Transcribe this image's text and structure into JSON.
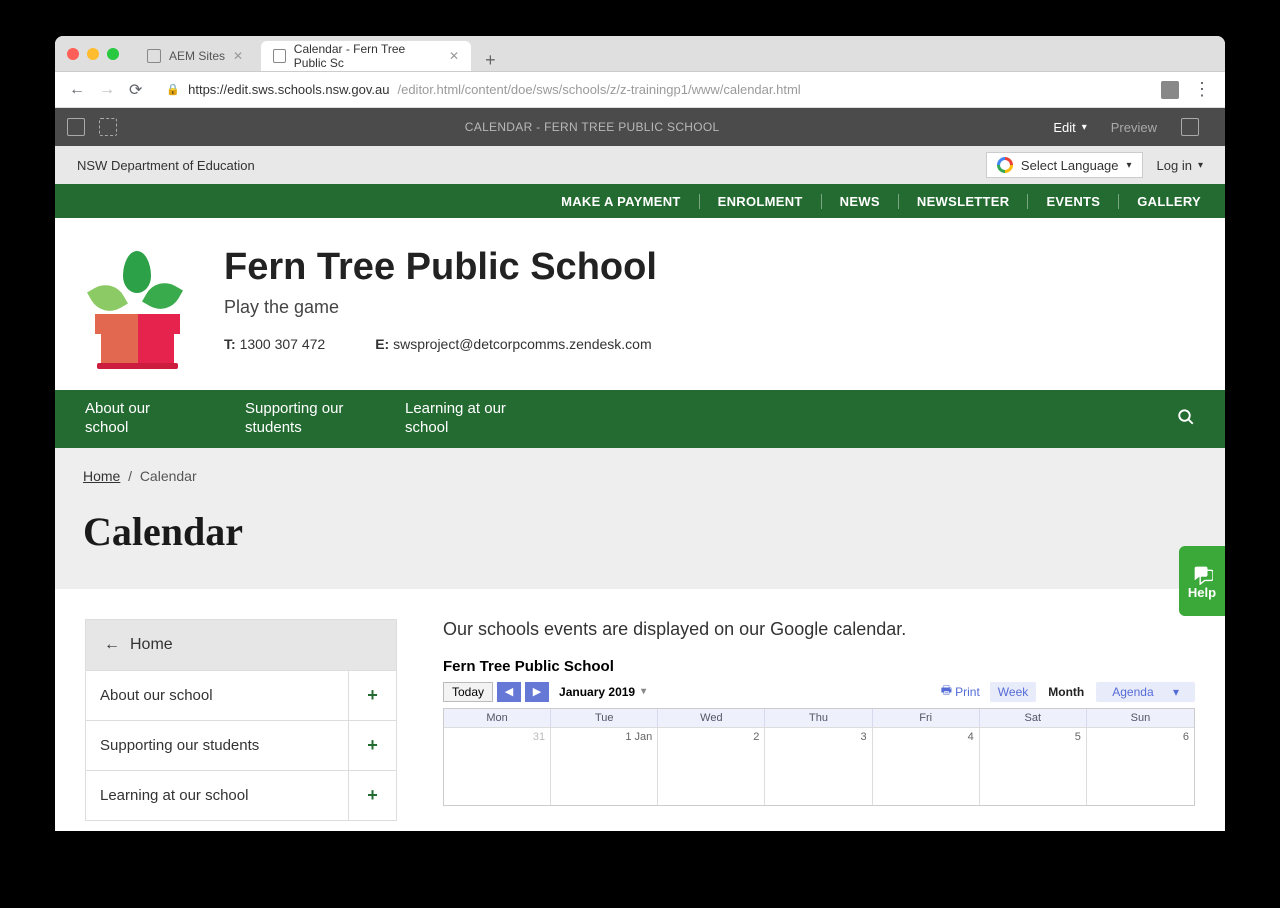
{
  "browser": {
    "tabs": [
      {
        "title": "AEM Sites",
        "active": false
      },
      {
        "title": "Calendar - Fern Tree Public Sc",
        "active": true
      }
    ],
    "url_secure_host": "https://edit.sws.schools.nsw.gov.au",
    "url_path": "/editor.html/content/doe/sws/schools/z/z-trainingp1/www/calendar.html"
  },
  "aem": {
    "title": "CALENDAR - FERN TREE PUBLIC SCHOOL",
    "edit": "Edit",
    "preview": "Preview"
  },
  "topstrip": {
    "dept": "NSW Department of Education",
    "lang": "Select Language",
    "login": "Log in"
  },
  "utilityNav": [
    "MAKE A PAYMENT",
    "ENROLMENT",
    "NEWS",
    "NEWSLETTER",
    "EVENTS",
    "GALLERY"
  ],
  "school": {
    "name": "Fern Tree Public School",
    "tagline": "Play the game",
    "phone_label": "T:",
    "phone": "1300 307 472",
    "email_label": "E:",
    "email": "swsproject@detcorpcomms.zendesk.com"
  },
  "mainNav": [
    "About our school",
    "Supporting our students",
    "Learning at our school"
  ],
  "breadcrumb": {
    "home": "Home",
    "current": "Calendar"
  },
  "pageTitle": "Calendar",
  "sideNav": {
    "home": "Home",
    "items": [
      "About our school",
      "Supporting our students",
      "Learning at our school"
    ]
  },
  "intro": "Our schools events are displayed on our Google calendar.",
  "calendar": {
    "title": "Fern Tree Public School",
    "today": "Today",
    "monthLabel": "January 2019",
    "print": "Print",
    "views": {
      "week": "Week",
      "month": "Month",
      "agenda": "Agenda"
    },
    "days": [
      "Mon",
      "Tue",
      "Wed",
      "Thu",
      "Fri",
      "Sat",
      "Sun"
    ],
    "row1": [
      "31",
      "1 Jan",
      "2",
      "3",
      "4",
      "5",
      "6"
    ]
  },
  "help": "Help"
}
